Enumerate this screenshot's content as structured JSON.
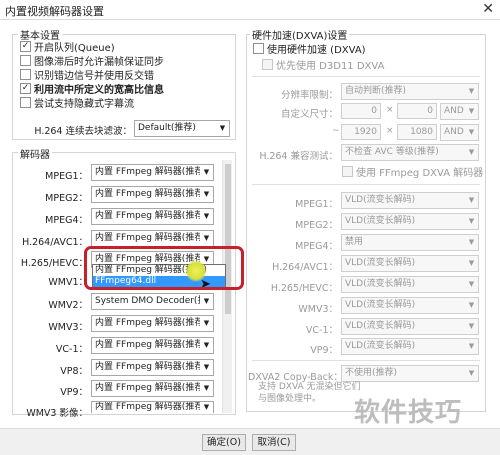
{
  "window": {
    "title": "内置视频解码器设置",
    "close_glyph": "✕"
  },
  "basic": {
    "title": "基本设置",
    "options": [
      {
        "label": "开启队列(Queue)",
        "checked": true
      },
      {
        "label": "图像滞后时允许漏帧保证同步",
        "checked": false
      },
      {
        "label": "识别错边信号并使用反交错",
        "checked": false
      },
      {
        "label": "利用流中所定义的宽高比信息",
        "checked": true,
        "bold": true
      },
      {
        "label": "尝试支持隐藏式字幕流",
        "checked": false
      }
    ],
    "deblock_label": "H.264 连续去块滤波：",
    "deblock_value": "Default(推荐)"
  },
  "decoders": {
    "title": "解码器",
    "rows": [
      {
        "label": "MPEG1：",
        "value": "内置 FFmpeg 解码器(推荐)"
      },
      {
        "label": "MPEG2：",
        "value": "内置 FFmpeg 解码器(推荐)"
      },
      {
        "label": "MPEG4：",
        "value": "内置 FFmpeg 解码器(推荐)"
      },
      {
        "label": "H.264/AVC1：",
        "value": "内置 FFmpeg 解码器(推荐)"
      },
      {
        "label": "H.265/HEVC：",
        "value": "内置 FFmpeg 解码器(推荐)"
      },
      {
        "label": "WMV1：",
        "value": ""
      },
      {
        "label": "WMV2：",
        "value": "System DMO Decoder(推荐)"
      },
      {
        "label": "WMV3：",
        "value": "内置 FFmpeg 解码器(推荐)"
      },
      {
        "label": "VC-1：",
        "value": "内置 FFmpeg 解码器(推荐)"
      },
      {
        "label": "VP8：",
        "value": "内置 FFmpeg 解码器(推荐)"
      },
      {
        "label": "VP9：",
        "value": "内置 FFmpeg 解码器(推荐)"
      },
      {
        "label": "WMV3 影像：",
        "value": "内置 FFmpeg 解码器(推荐)"
      }
    ],
    "dropdown_options": [
      "内置 FFmpeg 解码器(推荐)",
      "FFmpeg64.dll"
    ],
    "dropdown_selected": "FFmpeg64.dll"
  },
  "hw": {
    "title": "硬件加速(DXVA)设置",
    "use_hw_label": "使用硬件加速 (DXVA)",
    "use_hw_checked": false,
    "prefer_d3d11_label": "优先使用 D3D11 DXVA",
    "resolution_label": "分辨率限制：",
    "resolution_value": "自动判断(推荐)",
    "custom_size_label": "自定义尺寸：",
    "custom_w": "0",
    "custom_h": "0",
    "times_symbol": "×",
    "tilde_symbol": "~",
    "and_label": "AND",
    "range_w": "1920",
    "range_h": "1080",
    "compat_label": "H.264 兼容测试：",
    "compat_value": "不检查 AVC 等级(推荐)",
    "ffmpeg_dxva_label": "使用 FFmpeg DXVA 解码器",
    "ffmpeg_dxva_checked": false,
    "rows": [
      {
        "label": "MPEG1：",
        "value": "VLD(流变长解码)"
      },
      {
        "label": "MPEG2：",
        "value": "VLD(流变长解码)"
      },
      {
        "label": "MPEG4：",
        "value": "禁用"
      },
      {
        "label": "H.264/AVC1：",
        "value": "VLD(流变长解码)"
      },
      {
        "label": "H.265/HEVC：",
        "value": "VLD(流变长解码)"
      },
      {
        "label": "WMV3：",
        "value": "VLD(流变长解码)"
      },
      {
        "label": "VC-1：",
        "value": "VLD(流变长解码)"
      },
      {
        "label": "VP9：",
        "value": "VLD(流变长解码)"
      }
    ],
    "copyback_label": "DXVA2 Copy-Back：",
    "copyback_value": "不使用(推荐)",
    "hint_line1": "支持 DXVA 无混染但它们",
    "hint_line2": "与图像处理中。"
  },
  "buttons": {
    "ok": "确定(O)",
    "cancel": "取消(C)"
  },
  "watermark": "软件技巧"
}
